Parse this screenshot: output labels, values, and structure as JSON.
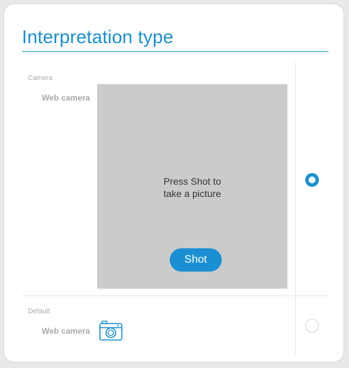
{
  "section": {
    "title": "Interpretation type"
  },
  "options": [
    {
      "group": "Camera",
      "source": "Web camera",
      "selected": true,
      "preview": {
        "hint_line1": "Press Shot to",
        "hint_line2": "take a picture",
        "shot_label": "Shot"
      }
    },
    {
      "group": "Default",
      "source": "Web camera",
      "selected": false,
      "icon": "camera-icon"
    }
  ],
  "colors": {
    "accent": "#1b8fd3",
    "title_rule": "#1a9ab1",
    "preview_bg": "#cbcbcb"
  }
}
